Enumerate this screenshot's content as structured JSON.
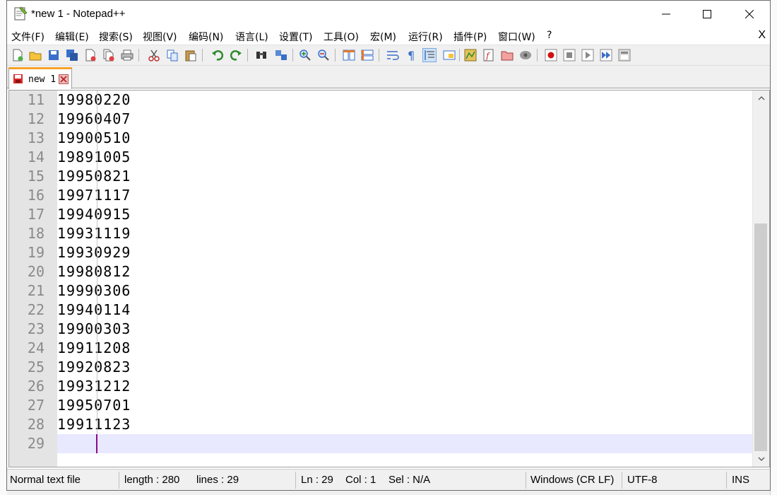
{
  "window": {
    "title": "*new 1 - Notepad++"
  },
  "menu": {
    "items": [
      "文件(F)",
      "编辑(E)",
      "搜索(S)",
      "视图(V)",
      "编码(N)",
      "语言(L)",
      "设置(T)",
      "工具(O)",
      "宏(M)",
      "运行(R)",
      "插件(P)",
      "窗口(W)",
      "?"
    ],
    "close": "X"
  },
  "toolbar": {
    "icons": [
      "new-file-icon",
      "open-file-icon",
      "save-icon",
      "save-all-icon",
      "close-icon",
      "close-all-icon",
      "print-icon",
      "cut-icon",
      "copy-icon",
      "paste-icon",
      "undo-icon",
      "redo-icon",
      "find-icon",
      "replace-icon",
      "zoom-in-icon",
      "zoom-out-icon",
      "sync-vertical-icon",
      "sync-horizontal-icon",
      "word-wrap-icon",
      "show-all-characters-icon",
      "indent-guide-icon",
      "user-defined-language-icon",
      "document-map-icon",
      "function-list-icon",
      "folder-as-workspace-icon",
      "monitoring-icon",
      "record-macro-icon",
      "stop-recording-icon",
      "playback-macro-icon",
      "run-macro-multiple-icon",
      "save-macro-icon"
    ]
  },
  "tabs": [
    {
      "label": "new 1",
      "modified": true
    }
  ],
  "editor": {
    "lines": [
      {
        "num": "11",
        "text": "19980220"
      },
      {
        "num": "12",
        "text": "19960407"
      },
      {
        "num": "13",
        "text": "19900510"
      },
      {
        "num": "14",
        "text": "19891005"
      },
      {
        "num": "15",
        "text": "19950821"
      },
      {
        "num": "16",
        "text": "19971117"
      },
      {
        "num": "17",
        "text": "19940915"
      },
      {
        "num": "18",
        "text": "19931119"
      },
      {
        "num": "19",
        "text": "19930929"
      },
      {
        "num": "20",
        "text": "19980812"
      },
      {
        "num": "21",
        "text": "19990306"
      },
      {
        "num": "22",
        "text": "19940114"
      },
      {
        "num": "23",
        "text": "19900303"
      },
      {
        "num": "24",
        "text": "19911208"
      },
      {
        "num": "25",
        "text": "19920823"
      },
      {
        "num": "26",
        "text": "19931212"
      },
      {
        "num": "27",
        "text": "19950701"
      },
      {
        "num": "28",
        "text": "19911123"
      },
      {
        "num": "29",
        "text": ""
      }
    ],
    "current_line": "29"
  },
  "status": {
    "file_type": "Normal text file",
    "length": "length : 280",
    "lines": "lines : 29",
    "ln": "Ln : 29",
    "col": "Col : 1",
    "sel": "Sel : N/A",
    "eol": "Windows (CR LF)",
    "encoding": "UTF-8",
    "mode": "INS"
  },
  "colors": {
    "tab_accent": "#f7a22a",
    "current_line": "#e8e8ff",
    "gutter": "#e4e4e4",
    "caret": "#8b0a8b"
  }
}
